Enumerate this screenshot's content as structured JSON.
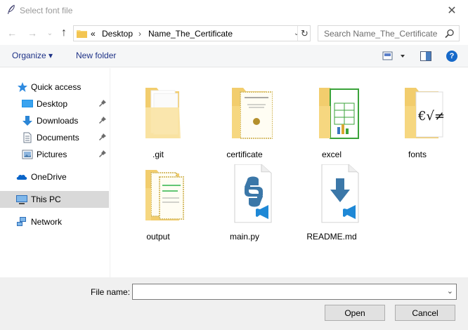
{
  "window": {
    "title": "Select font file",
    "close_glyph": "✕"
  },
  "navigation": {
    "back_glyph": "←",
    "forward_glyph": "→",
    "recent_glyph": "⌄",
    "up_glyph": "↑"
  },
  "address": {
    "overflow": "«",
    "crumbs": [
      "Desktop",
      "Name_The_Certificate"
    ],
    "separator": "›",
    "dropdown_glyph": "⌄",
    "refresh_glyph": "↻"
  },
  "search": {
    "placeholder": "Search Name_The_Certificate"
  },
  "toolbar": {
    "organize_label": "Organize ▾",
    "new_folder_label": "New folder",
    "help_glyph": "?"
  },
  "sidebar": {
    "items": [
      {
        "label": "Quick access",
        "icon": "star-icon",
        "pinned": false
      },
      {
        "label": "Desktop",
        "icon": "desktop-icon",
        "pinned": true
      },
      {
        "label": "Downloads",
        "icon": "download-icon",
        "pinned": true
      },
      {
        "label": "Documents",
        "icon": "document-icon",
        "pinned": true
      },
      {
        "label": "Pictures",
        "icon": "picture-icon",
        "pinned": true
      },
      {
        "label": "OneDrive",
        "icon": "cloud-icon",
        "pinned": false
      },
      {
        "label": "This PC",
        "icon": "computer-icon",
        "pinned": false,
        "selected": true
      },
      {
        "label": "Network",
        "icon": "network-icon",
        "pinned": false
      }
    ]
  },
  "files": [
    {
      "name": ".git",
      "kind": "folder"
    },
    {
      "name": "certificate",
      "kind": "folder"
    },
    {
      "name": "excel",
      "kind": "folder"
    },
    {
      "name": "fonts",
      "kind": "folder"
    },
    {
      "name": "output",
      "kind": "folder"
    },
    {
      "name": "main.py",
      "kind": "python-file"
    },
    {
      "name": "README.md",
      "kind": "markdown-file"
    }
  ],
  "footer": {
    "file_name_label": "File name:",
    "file_name_value": "",
    "file_name_dropdown_glyph": "⌄",
    "open_label": "Open",
    "cancel_label": "Cancel"
  },
  "colors": {
    "folder": "#f8d775",
    "folder_dark": "#e8b94a",
    "accent_blue": "#1669c9",
    "selection": "#d9d9d9",
    "footer_bg": "#f0f0f0"
  }
}
